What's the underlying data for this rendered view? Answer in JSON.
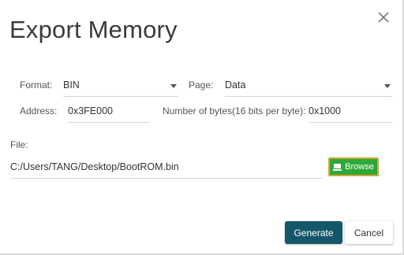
{
  "dialog": {
    "title": "Export Memory",
    "close_icon": "close-icon"
  },
  "format": {
    "label": "Format:",
    "value": "BIN"
  },
  "page": {
    "label": "Page:",
    "value": "Data"
  },
  "address": {
    "label": "Address:",
    "value": "0x3FE000"
  },
  "bytes": {
    "label": "Number of bytes(16 bits per byte):",
    "value": "0x1000"
  },
  "file": {
    "label": "File:",
    "value": "C:/Users/TANG/Desktop/BootROM.bin",
    "browse_label": "Browse",
    "browse_icon": "folder-icon"
  },
  "actions": {
    "generate_label": "Generate",
    "cancel_label": "Cancel"
  },
  "colors": {
    "generate_bg": "#15576a",
    "browse_bg": "#2ea83a",
    "browse_border": "#d4a531"
  }
}
